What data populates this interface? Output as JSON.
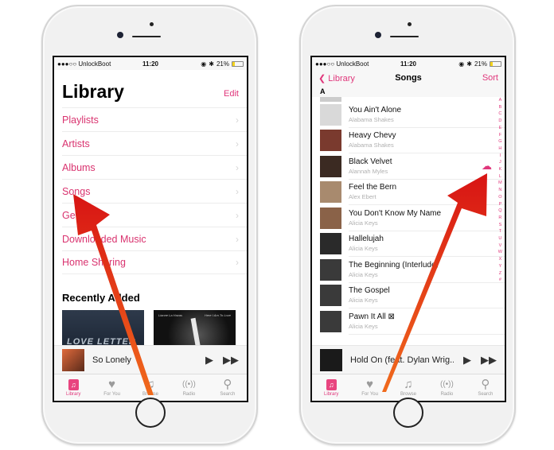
{
  "status_bar": {
    "carrier": "●●●○○ UnlockBoot",
    "wifi_icon": "wifi-icon",
    "time": "11:20",
    "battery_percent": "21%"
  },
  "left_screen": {
    "title": "Library",
    "edit_label": "Edit",
    "menu_items": [
      {
        "label": "Playlists"
      },
      {
        "label": "Artists"
      },
      {
        "label": "Albums"
      },
      {
        "label": "Songs"
      },
      {
        "label": "Genres"
      },
      {
        "label": "Downloaded Music"
      },
      {
        "label": "Home Sharing"
      }
    ],
    "recently_added_title": "Recently Added",
    "albums": [
      {
        "cover_text": "LOVE LETTER"
      },
      {
        "cover_text_left": "Lianne La Havas",
        "cover_text_right": "Here I Am To Love"
      }
    ],
    "now_playing": {
      "title": "So Lonely"
    }
  },
  "right_screen": {
    "back_label": "Library",
    "title": "Songs",
    "sort_label": "Sort",
    "section_letter": "A",
    "songs": [
      {
        "title": "You Ain't Alone",
        "artist": "Alabama Shakes",
        "art_color": "#d9d9d9"
      },
      {
        "title": "Heavy Chevy",
        "artist": "Alabama Shakes",
        "art_color": "#7a3a2e"
      },
      {
        "title": "Black Velvet",
        "artist": "Alannah Myles",
        "art_color": "#3b2a22",
        "cloud_download": true
      },
      {
        "title": "Feel the Bern",
        "artist": "Alex Ebert",
        "art_color": "#a88a6e"
      },
      {
        "title": "You Don't Know My Name",
        "artist": "Alicia Keys",
        "art_color": "#8a6248"
      },
      {
        "title": "Hallelujah",
        "artist": "Alicia Keys",
        "art_color": "#2a2a2a"
      },
      {
        "title": "The Beginning (Interlude)",
        "artist": "Alicia Keys",
        "art_color": "#3a3a3a"
      },
      {
        "title": "The Gospel",
        "artist": "Alicia Keys",
        "art_color": "#3a3a3a"
      },
      {
        "title": "Pawn It All ⊠",
        "artist": "Alicia Keys",
        "art_color": "#3a3a3a"
      }
    ],
    "index_letters": [
      "A",
      "B",
      "C",
      "D",
      "E",
      "F",
      "G",
      "H",
      "I",
      "J",
      "K",
      "L",
      "M",
      "N",
      "O",
      "P",
      "Q",
      "R",
      "S",
      "T",
      "U",
      "V",
      "W",
      "X",
      "Y",
      "Z",
      "#"
    ],
    "now_playing": {
      "title": "Hold On (feat. Dylan Wrig..."
    }
  },
  "tab_bar": [
    {
      "label": "Library",
      "icon": "library-icon",
      "active": true
    },
    {
      "label": "For You",
      "icon": "heart-icon"
    },
    {
      "label": "Browse",
      "icon": "music-note-icon"
    },
    {
      "label": "Radio",
      "icon": "radio-icon"
    },
    {
      "label": "Search",
      "icon": "search-icon"
    }
  ],
  "colors": {
    "accent": "#e0367b",
    "arrow": "#e8331c"
  }
}
